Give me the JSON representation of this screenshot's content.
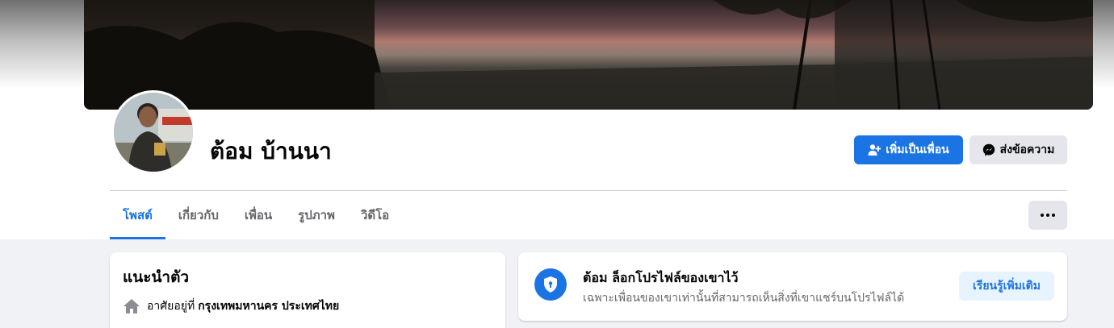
{
  "profile": {
    "name": "ต้อม บ้านนา",
    "add_friend_label": "เพิ่มเป็นเพื่อน",
    "message_label": "ส่งข้อความ"
  },
  "tabs": [
    {
      "label": "โพสต์",
      "active": true
    },
    {
      "label": "เกี่ยวกับ",
      "active": false
    },
    {
      "label": "เพื่อน",
      "active": false
    },
    {
      "label": "รูปภาพ",
      "active": false
    },
    {
      "label": "วิดีโอ",
      "active": false
    }
  ],
  "intro": {
    "title": "แนะนำตัว",
    "lives_prefix": "อาศัยอยู่ที่",
    "lives_place": "กรุงเทพมหานคร ประเทศไทย"
  },
  "locked": {
    "title": "ต้อม ล็อกโปรไฟล์ของเขาไว้",
    "subtitle": "เฉพาะเพื่อนของเขาเท่านั้นที่สามารถเห็นสิ่งที่เขาแชร์บนโปรไฟล์ได้",
    "learn_more_label": "เรียนรู้เพิ่มเติม"
  },
  "colors": {
    "accent": "#1b74e4",
    "secondary_button": "#e4e6eb",
    "feed_background": "#f0f2f5",
    "muted_text": "#65676b"
  },
  "icons": {
    "add_friend": "person-plus-icon",
    "message": "messenger-icon",
    "more": "more-dots-icon",
    "home": "home-icon",
    "lock": "shield-lock-icon"
  }
}
